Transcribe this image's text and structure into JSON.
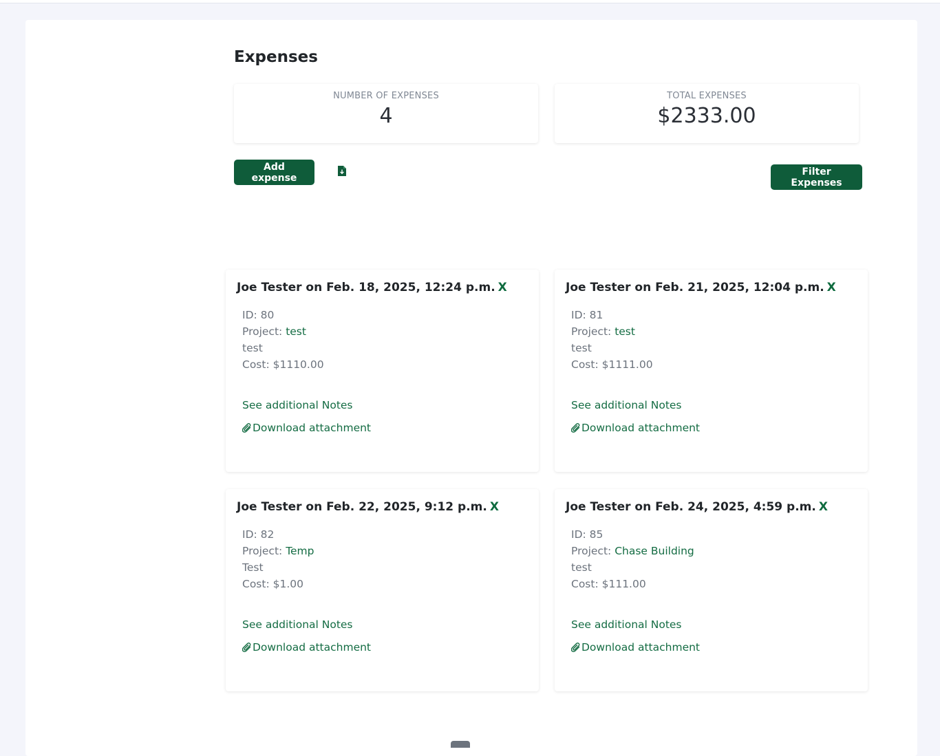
{
  "page": {
    "title": "Expenses"
  },
  "stats": {
    "count_label": "NUMBER OF EXPENSES",
    "count_value": "4",
    "total_label": "TOTAL EXPENSES",
    "total_value": "$2333.00"
  },
  "toolbar": {
    "add_label": "Add expense",
    "export_icon": "file-download-icon",
    "filter_label": "Filter Expenses"
  },
  "expenses": [
    {
      "title": "Joe Tester on Feb. 18, 2025, 12:24 p.m.",
      "delete": "X",
      "id_label": "ID: 80",
      "project_prefix": "Project: ",
      "project": "test",
      "description": "test",
      "cost": "Cost: $1110.00",
      "notes_link": "See additional Notes",
      "attachment_link": "Download attachment"
    },
    {
      "title": "Joe Tester on Feb. 21, 2025, 12:04 p.m.",
      "delete": "X",
      "id_label": "ID: 81",
      "project_prefix": "Project: ",
      "project": "test",
      "description": "test",
      "cost": "Cost: $1111.00",
      "notes_link": "See additional Notes",
      "attachment_link": "Download attachment"
    },
    {
      "title": "Joe Tester on Feb. 22, 2025, 9:12 p.m.",
      "delete": "X",
      "id_label": "ID: 82",
      "project_prefix": "Project: ",
      "project": "Temp",
      "description": "Test",
      "cost": "Cost: $1.00",
      "notes_link": "See additional Notes",
      "attachment_link": "Download attachment"
    },
    {
      "title": "Joe Tester on Feb. 24, 2025, 4:59 p.m.",
      "delete": "X",
      "id_label": "ID: 85",
      "project_prefix": "Project: ",
      "project": "Chase Building",
      "description": "test",
      "cost": "Cost: $111.00",
      "notes_link": "See additional Notes",
      "attachment_link": "Download attachment"
    }
  ],
  "colors": {
    "accent": "#0f5c3a",
    "link": "#146c43",
    "background": "#f4f5fb"
  }
}
